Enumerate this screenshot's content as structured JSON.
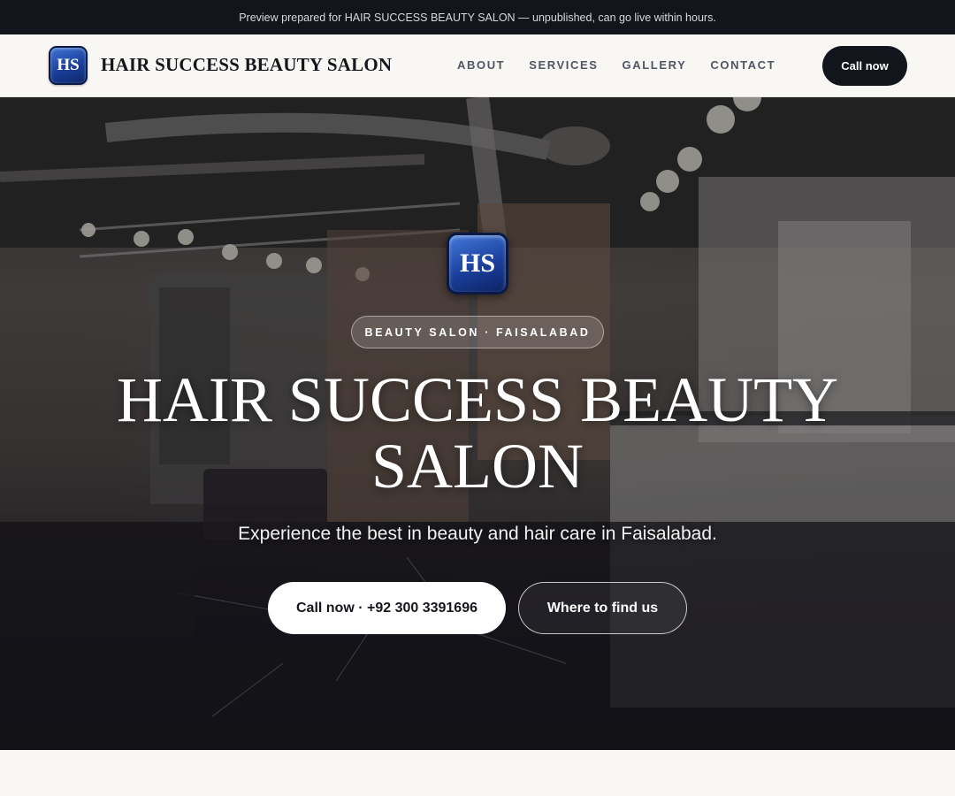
{
  "banner": {
    "text": "Preview prepared for HAIR SUCCESS BEAUTY SALON — unpublished, can go live within hours."
  },
  "header": {
    "logo_text": "HS",
    "brand_name": "HAIR SUCCESS BEAUTY SALON",
    "nav": [
      {
        "label": "ABOUT"
      },
      {
        "label": "SERVICES"
      },
      {
        "label": "GALLERY"
      },
      {
        "label": "CONTACT"
      }
    ],
    "cta_label": "Call now"
  },
  "hero": {
    "logo_text": "HS",
    "pill": "BEAUTY SALON · FAISALABAD",
    "title": "HAIR SUCCESS BEAUTY SALON",
    "subtitle": "Experience the best in beauty and hair care in Faisalabad.",
    "primary_button": "Call now · +92 300 3391696",
    "secondary_button": "Where to find us"
  },
  "colors": {
    "topbar_bg": "#12151c",
    "page_bg": "#f8f7f4",
    "logo_blue": "#1b3f9b",
    "cta_dark": "#12151c"
  }
}
